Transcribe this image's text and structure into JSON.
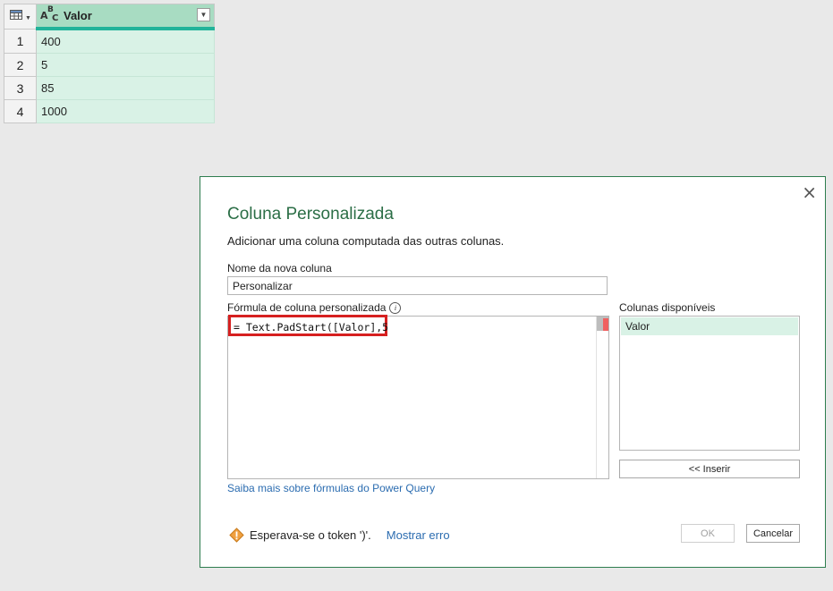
{
  "table": {
    "column_name": "Valor",
    "column_type_icon": "abc-text-type-icon",
    "type_glyph": {
      "a": "A",
      "b": "B",
      "c": "C"
    },
    "rows": [
      {
        "num": "1",
        "value": "400"
      },
      {
        "num": "2",
        "value": "5"
      },
      {
        "num": "3",
        "value": "85"
      },
      {
        "num": "4",
        "value": "1000"
      }
    ]
  },
  "dialog": {
    "title": "Coluna Personalizada",
    "subtitle": "Adicionar uma coluna computada das outras colunas.",
    "new_column_label": "Nome da nova coluna",
    "new_column_value": "Personalizar",
    "formula_label": "Fórmula de coluna personalizada",
    "formula_text": "= Text.PadStart([Valor],5",
    "available_columns_label": "Colunas disponíveis",
    "available_columns": [
      "Valor"
    ],
    "insert_button": "<< Inserir",
    "learn_more_link": "Saiba mais sobre fórmulas do Power Query",
    "error_message": "Esperava-se o token ')'.",
    "show_error_link": "Mostrar erro",
    "ok_button": "OK",
    "cancel_button": "Cancelar",
    "close_glyph": "×"
  },
  "colors": {
    "dialog_border": "#2e7d4f",
    "title": "#2b6e46",
    "column_header": "#a8dcc2",
    "cell": "#d9f2e6",
    "highlight": "#d62020",
    "link": "#2b6cb0"
  }
}
